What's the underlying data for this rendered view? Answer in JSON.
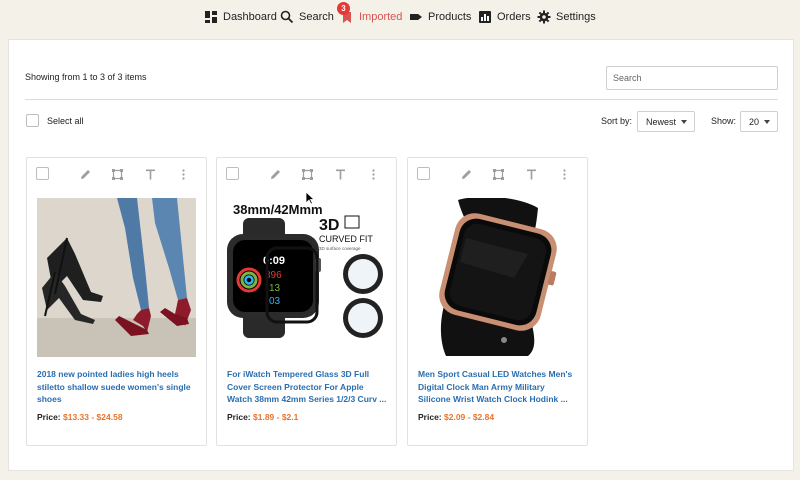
{
  "nav": {
    "items": [
      {
        "label": "Dashboard",
        "icon": "dashboard-icon"
      },
      {
        "label": "Search",
        "icon": "search-icon"
      },
      {
        "label": "Imported",
        "icon": "bookmark-icon",
        "badge": "3",
        "active": true
      },
      {
        "label": "Products",
        "icon": "tag-icon"
      },
      {
        "label": "Orders",
        "icon": "bar-chart-icon"
      },
      {
        "label": "Settings",
        "icon": "gear-icon"
      }
    ]
  },
  "toolbar": {
    "showing_text": "Showing from 1 to 3 of 3 items",
    "search_placeholder": "Search",
    "select_all_label": "Select all",
    "sort_label": "Sort by:",
    "sort_value": "Newest",
    "show_label": "Show:",
    "show_value": "20"
  },
  "products": [
    {
      "title": "2018 new pointed ladies high heels stiletto shallow suede women's single shoes",
      "price_label": "Price:",
      "price": "$13.33 - $24.58"
    },
    {
      "title": "For iWatch Tempered Glass 3D Full Cover Screen Protector For Apple Watch 38mm 42mm Series 1/2/3 Curv ...",
      "price_label": "Price:",
      "price": "$1.89 - $2.1",
      "image_text": {
        "size": "38mm/42Mmm",
        "badge": "3D",
        "curved": "CURVED FIT",
        "coverage": "3D surface coverage",
        "time": "0:09",
        "n1": "396",
        "n2": "13",
        "n3": "03"
      }
    },
    {
      "title": "Men Sport Casual LED Watches Men's Digital Clock Man Army Military Silicone Wrist Watch Clock Hodink ...",
      "price_label": "Price:",
      "price": "$2.09 - $2.84"
    }
  ],
  "colors": {
    "accent": "#d9534f",
    "link": "#2a6eb0",
    "price": "#e8742b",
    "background": "#f4f1e9"
  }
}
